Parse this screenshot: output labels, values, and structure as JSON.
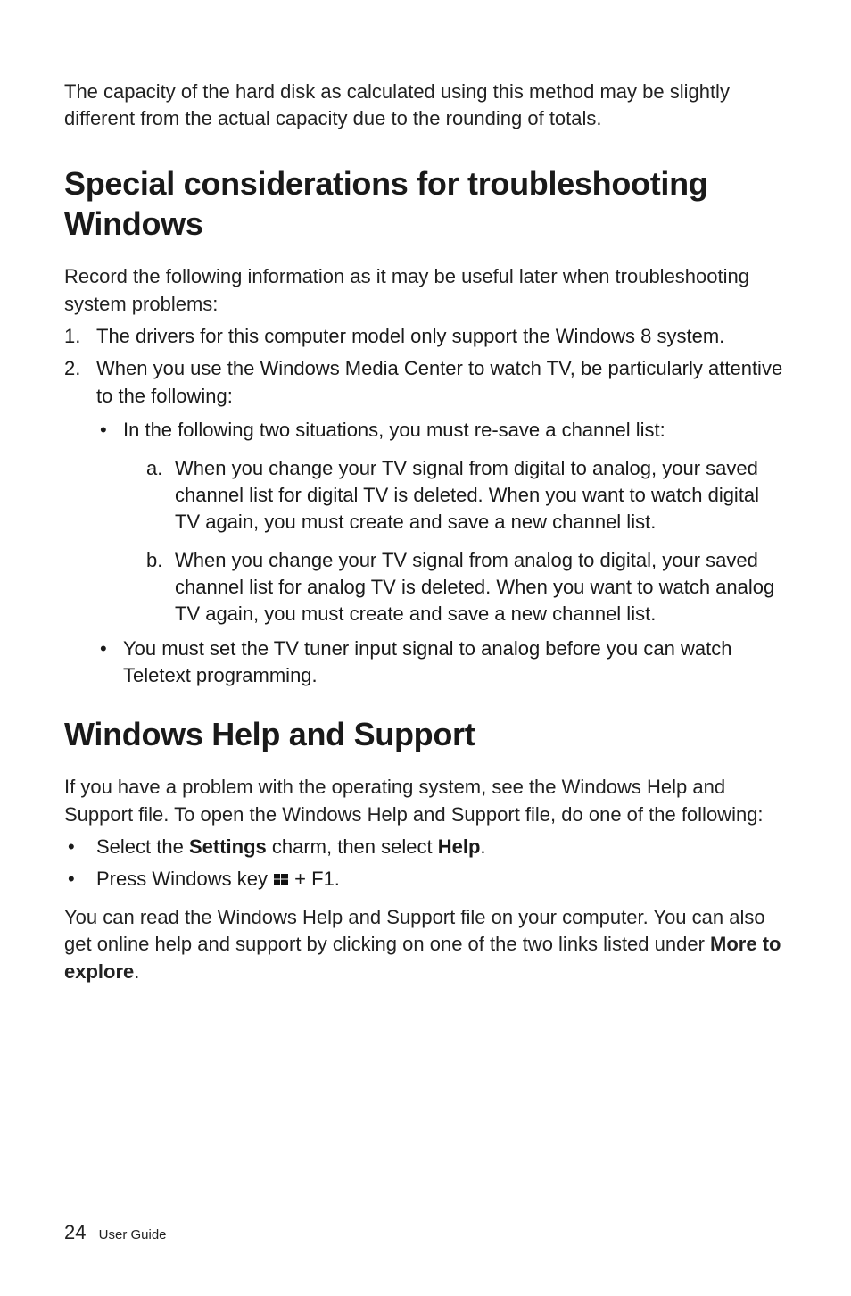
{
  "intro_paragraph": "The capacity of the hard disk as calculated using this method may be slightly different from the actual capacity due to the rounding of totals.",
  "section1": {
    "heading": "Special considerations for troubleshooting Windows",
    "lead": "Record the following information as it may be useful later when troubleshooting system problems:",
    "item1": "The drivers for this computer model only support the Windows 8 system.",
    "item2_lead": "When you use the Windows Media Center to watch TV, be particularly attentive to the following:",
    "bullet1_lead": "In the following two situations, you must re-save a channel list:",
    "sub_a": "When you change your TV signal from digital to analog, your saved channel list for digital TV is deleted. When you want to watch digital TV again, you must create and save a new channel list.",
    "sub_b": "When you change your TV signal from analog to digital, your saved channel list for analog TV is deleted. When you want to watch analog TV again, you must create and save a new channel list.",
    "bullet2": "You must set the TV tuner input signal to analog before you can watch Teletext programming."
  },
  "section2": {
    "heading": "Windows Help and Support",
    "lead": "If you have a problem with the operating system, see the Windows Help and Support file. To open the Windows Help and Support file, do one of the following:",
    "bullet1_pre": "Select the ",
    "bullet1_bold1": "Settings",
    "bullet1_mid": " charm, then select ",
    "bullet1_bold2": "Help",
    "bullet1_post": ".",
    "bullet2_pre": "Press Windows key ",
    "bullet2_post": " + F1.",
    "closing_pre": "You can read the Windows Help and Support file on your computer. You can also get online help and support by clicking on one of the two links listed under ",
    "closing_bold": "More to explore",
    "closing_post": "."
  },
  "footer": {
    "page_number": "24",
    "label": "User Guide"
  }
}
